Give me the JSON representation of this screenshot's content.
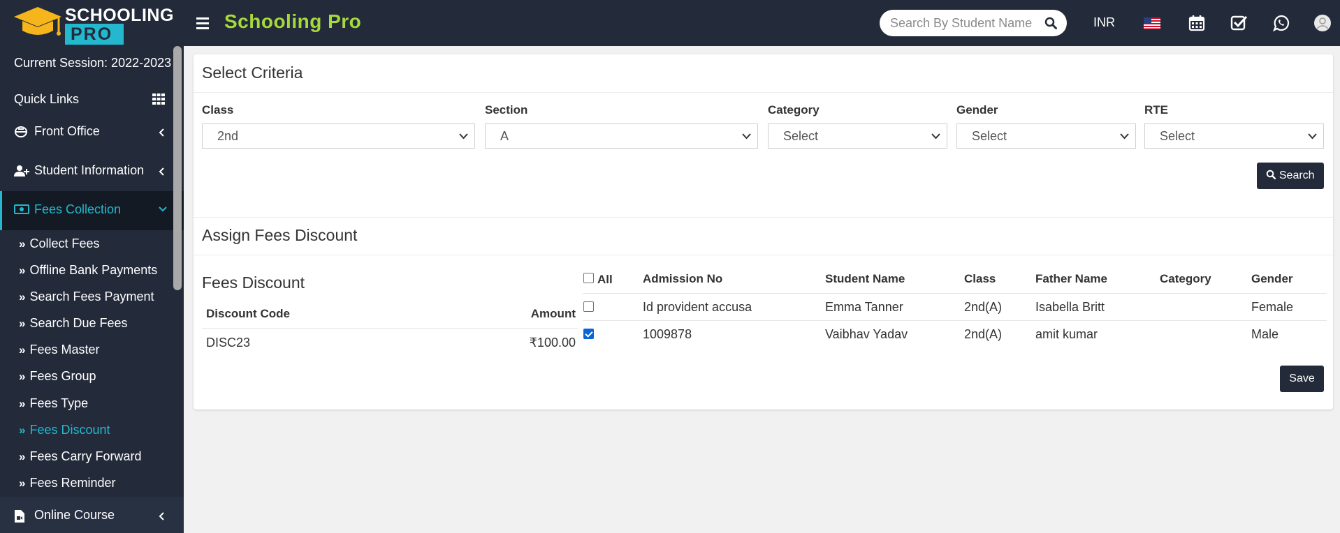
{
  "header": {
    "logo_line1": "SCHOOLING",
    "logo_line2": "PRO",
    "app_title": "Schooling Pro",
    "search_placeholder": "Search By Student Name",
    "currency": "INR",
    "accent_color": "#a6d93b",
    "brand_color": "#23b8ce"
  },
  "sidebar": {
    "session": "Current Session: 2022-2023",
    "quick_links": "Quick Links",
    "menus": {
      "front_office": "Front Office",
      "student_information": "Student Information",
      "fees_collection": "Fees Collection",
      "online_course": "Online Course"
    },
    "sub_items": [
      {
        "label": "Collect Fees"
      },
      {
        "label": "Offline Bank Payments"
      },
      {
        "label": "Search Fees Payment"
      },
      {
        "label": "Search Due Fees"
      },
      {
        "label": "Fees Master"
      },
      {
        "label": "Fees Group"
      },
      {
        "label": "Fees Type"
      },
      {
        "label": "Fees Discount"
      },
      {
        "label": "Fees Carry Forward"
      },
      {
        "label": "Fees Reminder"
      }
    ]
  },
  "criteria": {
    "title": "Select Criteria",
    "fields": {
      "class": {
        "label": "Class",
        "value": "2nd"
      },
      "section": {
        "label": "Section",
        "value": "A"
      },
      "category": {
        "label": "Category",
        "value": "Select"
      },
      "gender": {
        "label": "Gender",
        "value": "Select"
      },
      "rte": {
        "label": "RTE",
        "value": "Select"
      }
    },
    "search_button": "Search"
  },
  "assign": {
    "title": "Assign Fees Discount",
    "discount_panel": {
      "title": "Fees Discount",
      "headers": {
        "code": "Discount Code",
        "amount": "Amount"
      },
      "row": {
        "code": "DISC23",
        "amount": "₹100.00"
      }
    },
    "table": {
      "headers": {
        "all": "All",
        "admission": "Admission No",
        "student": "Student Name",
        "class": "Class",
        "father": "Father Name",
        "category": "Category",
        "gender": "Gender"
      },
      "rows": [
        {
          "admission": "Id provident accusa",
          "student": "Emma Tanner",
          "class": "2nd(A)",
          "father": "Isabella Britt",
          "category": "",
          "gender": "Female",
          "checked": false
        },
        {
          "admission": "1009878",
          "student": "Vaibhav Yadav",
          "class": "2nd(A)",
          "father": "amit kumar",
          "category": "",
          "gender": "Male",
          "checked": true
        }
      ]
    },
    "save_button": "Save"
  }
}
